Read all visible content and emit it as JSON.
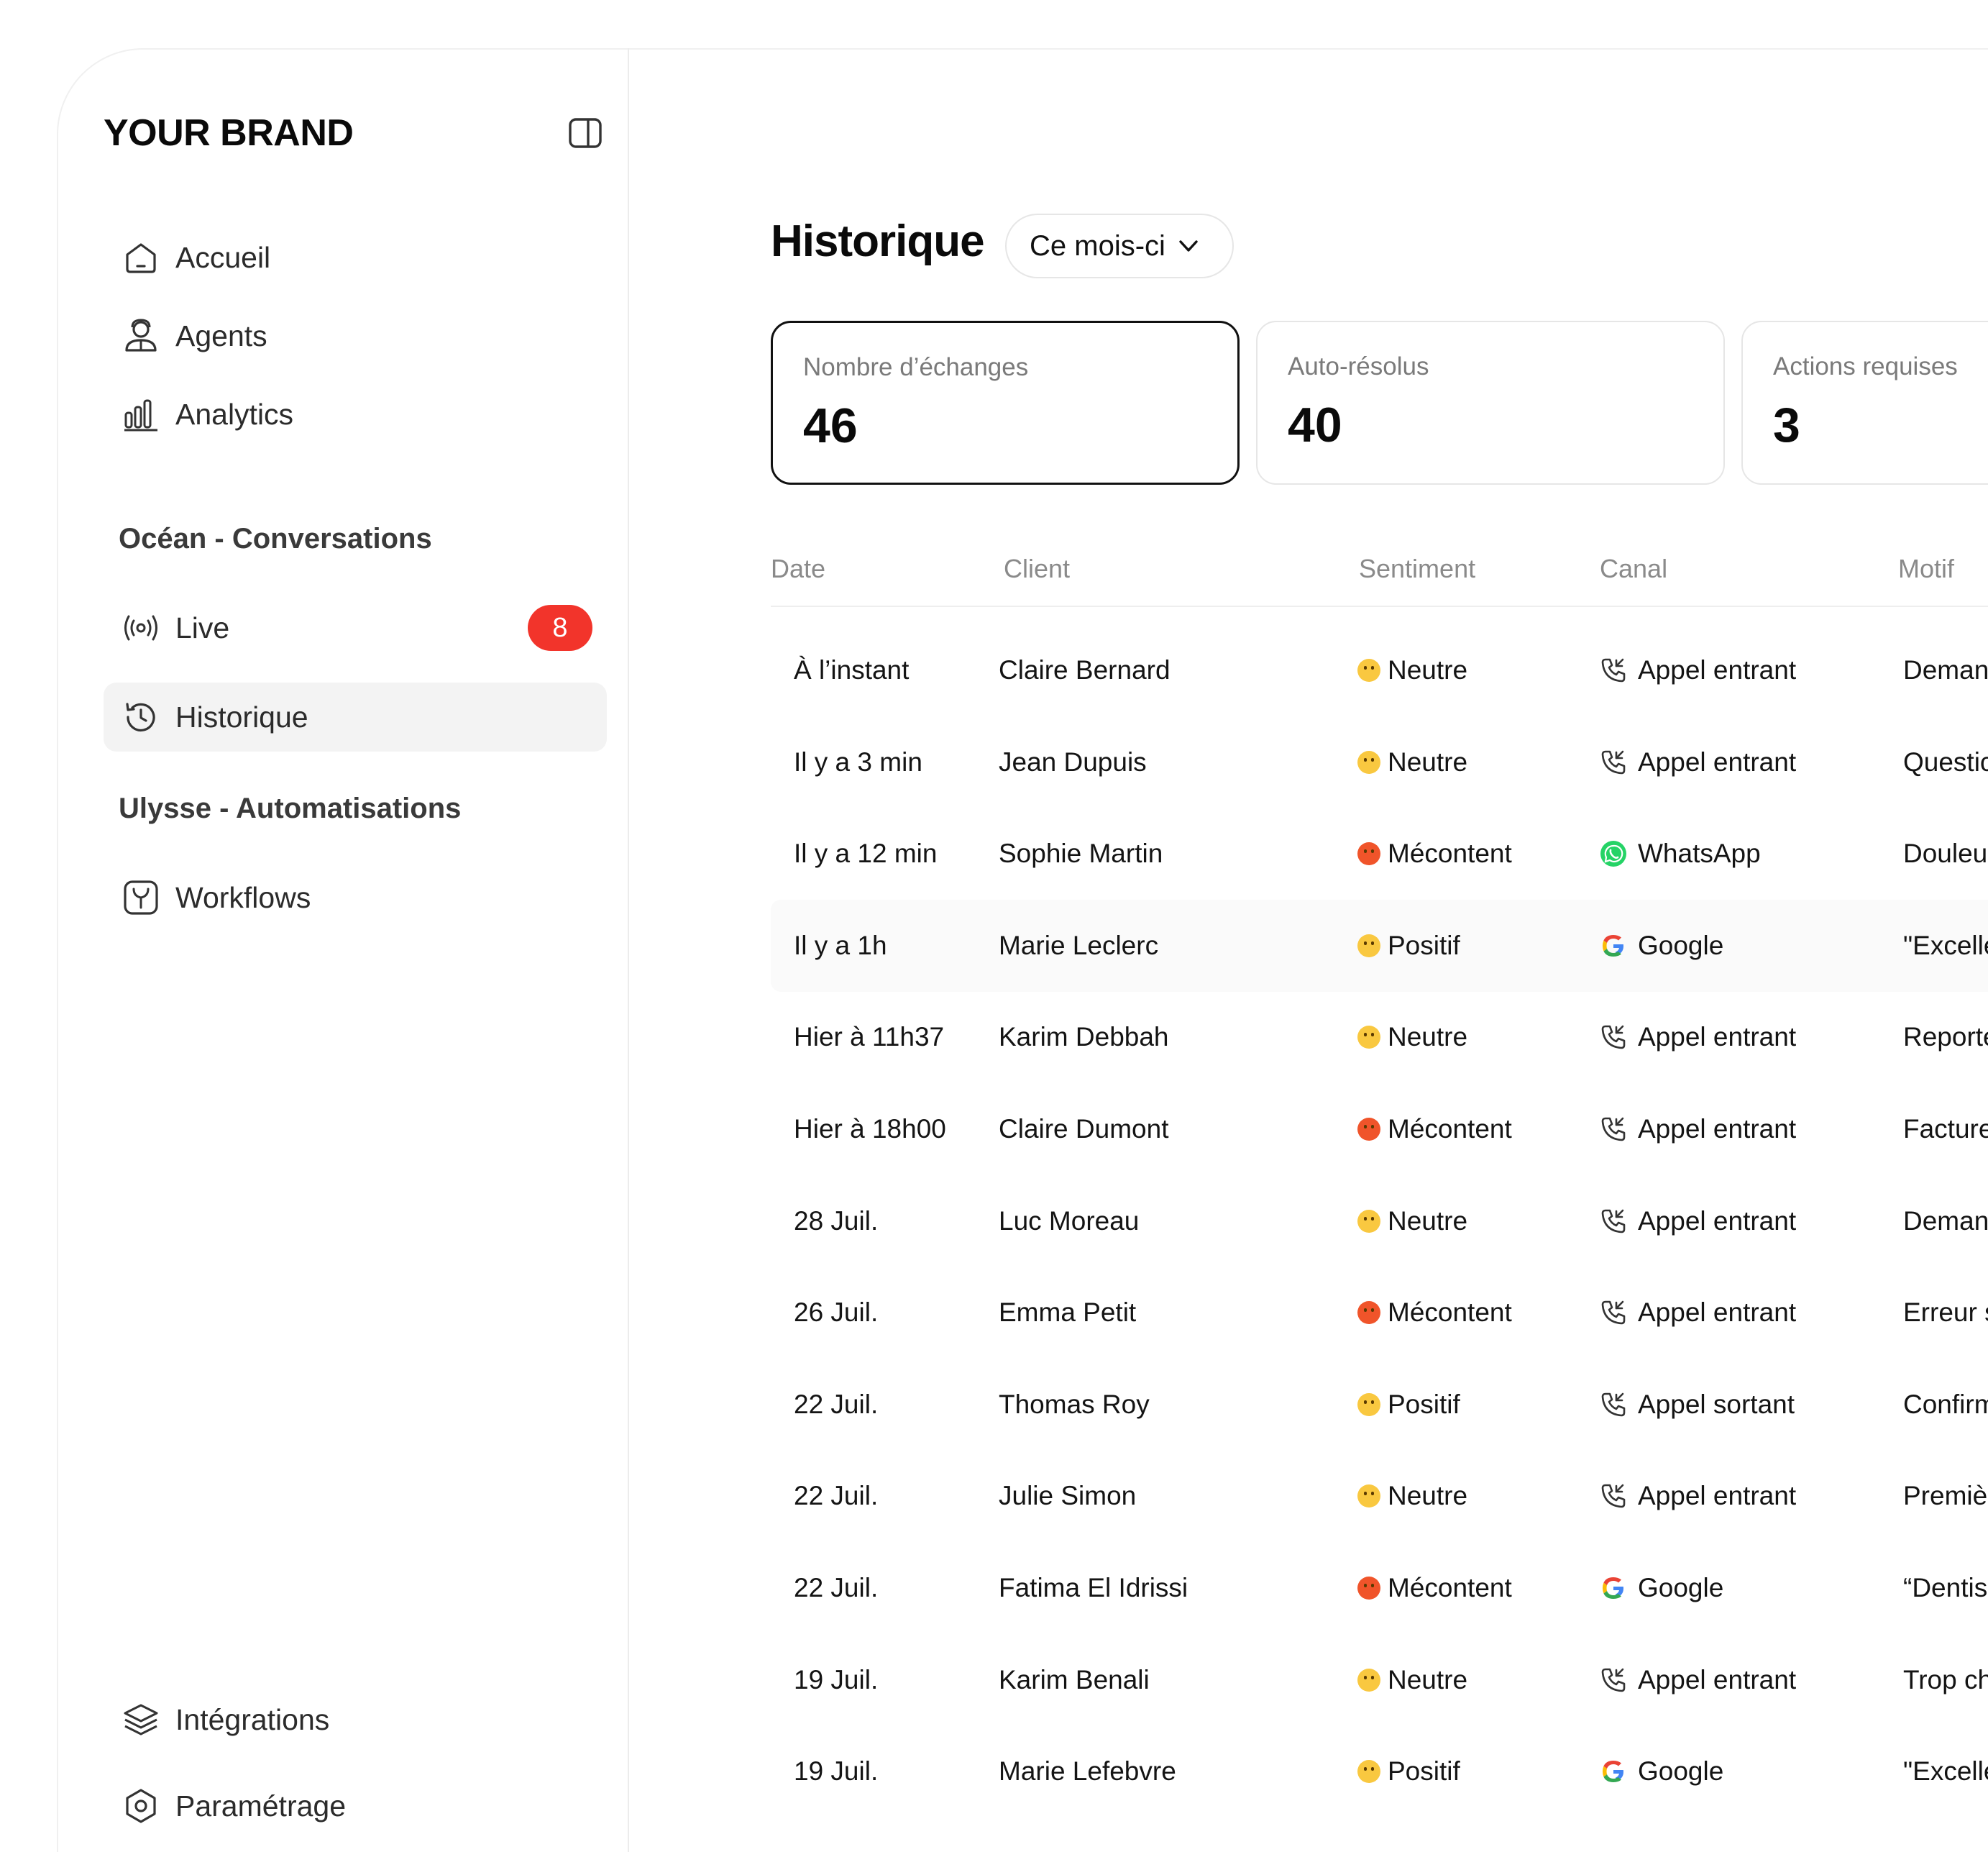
{
  "sidebar": {
    "brand": "YOUR BRAND",
    "nav": [
      {
        "label": "Accueil",
        "icon": "home-icon"
      },
      {
        "label": "Agents",
        "icon": "agent-icon"
      },
      {
        "label": "Analytics",
        "icon": "bar-chart-icon"
      }
    ],
    "section_ocean": "Océan - Conversations",
    "live": {
      "label": "Live",
      "badge": "8"
    },
    "historique": {
      "label": "Historique"
    },
    "section_ulysse": "Ulysse - Automatisations",
    "workflows": {
      "label": "Workflows"
    },
    "bottom": [
      {
        "label": "Intégrations",
        "icon": "layers-icon"
      },
      {
        "label": "Paramétrage",
        "icon": "settings-hex-icon"
      }
    ]
  },
  "main": {
    "title": "Historique",
    "period": "Ce mois-ci",
    "stats": [
      {
        "label": "Nombre d’échanges",
        "value": "46"
      },
      {
        "label": "Auto-résolus",
        "value": "40"
      },
      {
        "label": "Actions requises",
        "value": "3"
      }
    ],
    "columns": [
      "Date",
      "Client",
      "Sentiment",
      "Canal",
      "Motif"
    ],
    "rows": [
      {
        "date": "À l’instant",
        "client": "Claire Bernard",
        "sentiment": "Neutre",
        "canal": "Appel entrant",
        "motif": "Deman"
      },
      {
        "date": "Il y a 3 min",
        "client": "Jean Dupuis",
        "sentiment": "Neutre",
        "canal": "Appel entrant",
        "motif": "Questic"
      },
      {
        "date": "Il y a 12 min",
        "client": "Sophie Martin",
        "sentiment": "Mécontent",
        "canal": "WhatsApp",
        "motif": "Douleu"
      },
      {
        "date": "Il y a 1h",
        "client": "Marie Leclerc",
        "sentiment": "Positif",
        "canal": "Google",
        "motif": "\"Excelle"
      },
      {
        "date": "Hier à 11h37",
        "client": "Karim Debbah",
        "sentiment": "Neutre",
        "canal": "Appel entrant",
        "motif": "Reporte"
      },
      {
        "date": "Hier à 18h00",
        "client": "Claire Dumont",
        "sentiment": "Mécontent",
        "canal": "Appel entrant",
        "motif": "Facture"
      },
      {
        "date": "28 Juil.",
        "client": "Luc Moreau",
        "sentiment": "Neutre",
        "canal": "Appel entrant",
        "motif": "Deman"
      },
      {
        "date": "26 Juil.",
        "client": "Emma Petit",
        "sentiment": "Mécontent",
        "canal": "Appel entrant",
        "motif": "Erreur s"
      },
      {
        "date": "22 Juil.",
        "client": "Thomas Roy",
        "sentiment": "Positif",
        "canal": "Appel sortant",
        "motif": "Confirm"
      },
      {
        "date": "22 Juil.",
        "client": "Julie Simon",
        "sentiment": "Neutre",
        "canal": "Appel entrant",
        "motif": "Premiè"
      },
      {
        "date": "22 Juil.",
        "client": "Fatima El Idrissi",
        "sentiment": "Mécontent",
        "canal": "Google",
        "motif": "“Dentis"
      },
      {
        "date": "19 Juil.",
        "client": "Karim Benali",
        "sentiment": "Neutre",
        "canal": "Appel entrant",
        "motif": "Trop ch"
      },
      {
        "date": "19 Juil.",
        "client": "Marie Lefebvre",
        "sentiment": "Positif",
        "canal": "Google",
        "motif": "\"Excelle"
      }
    ]
  },
  "colors": {
    "badge": "#f2342b",
    "active_bg": "#f3f3f3",
    "whatsapp": "#25d366",
    "google_blue": "#4285f4",
    "google_red": "#ea4335",
    "google_yellow": "#fbbc05",
    "google_green": "#34a853"
  }
}
